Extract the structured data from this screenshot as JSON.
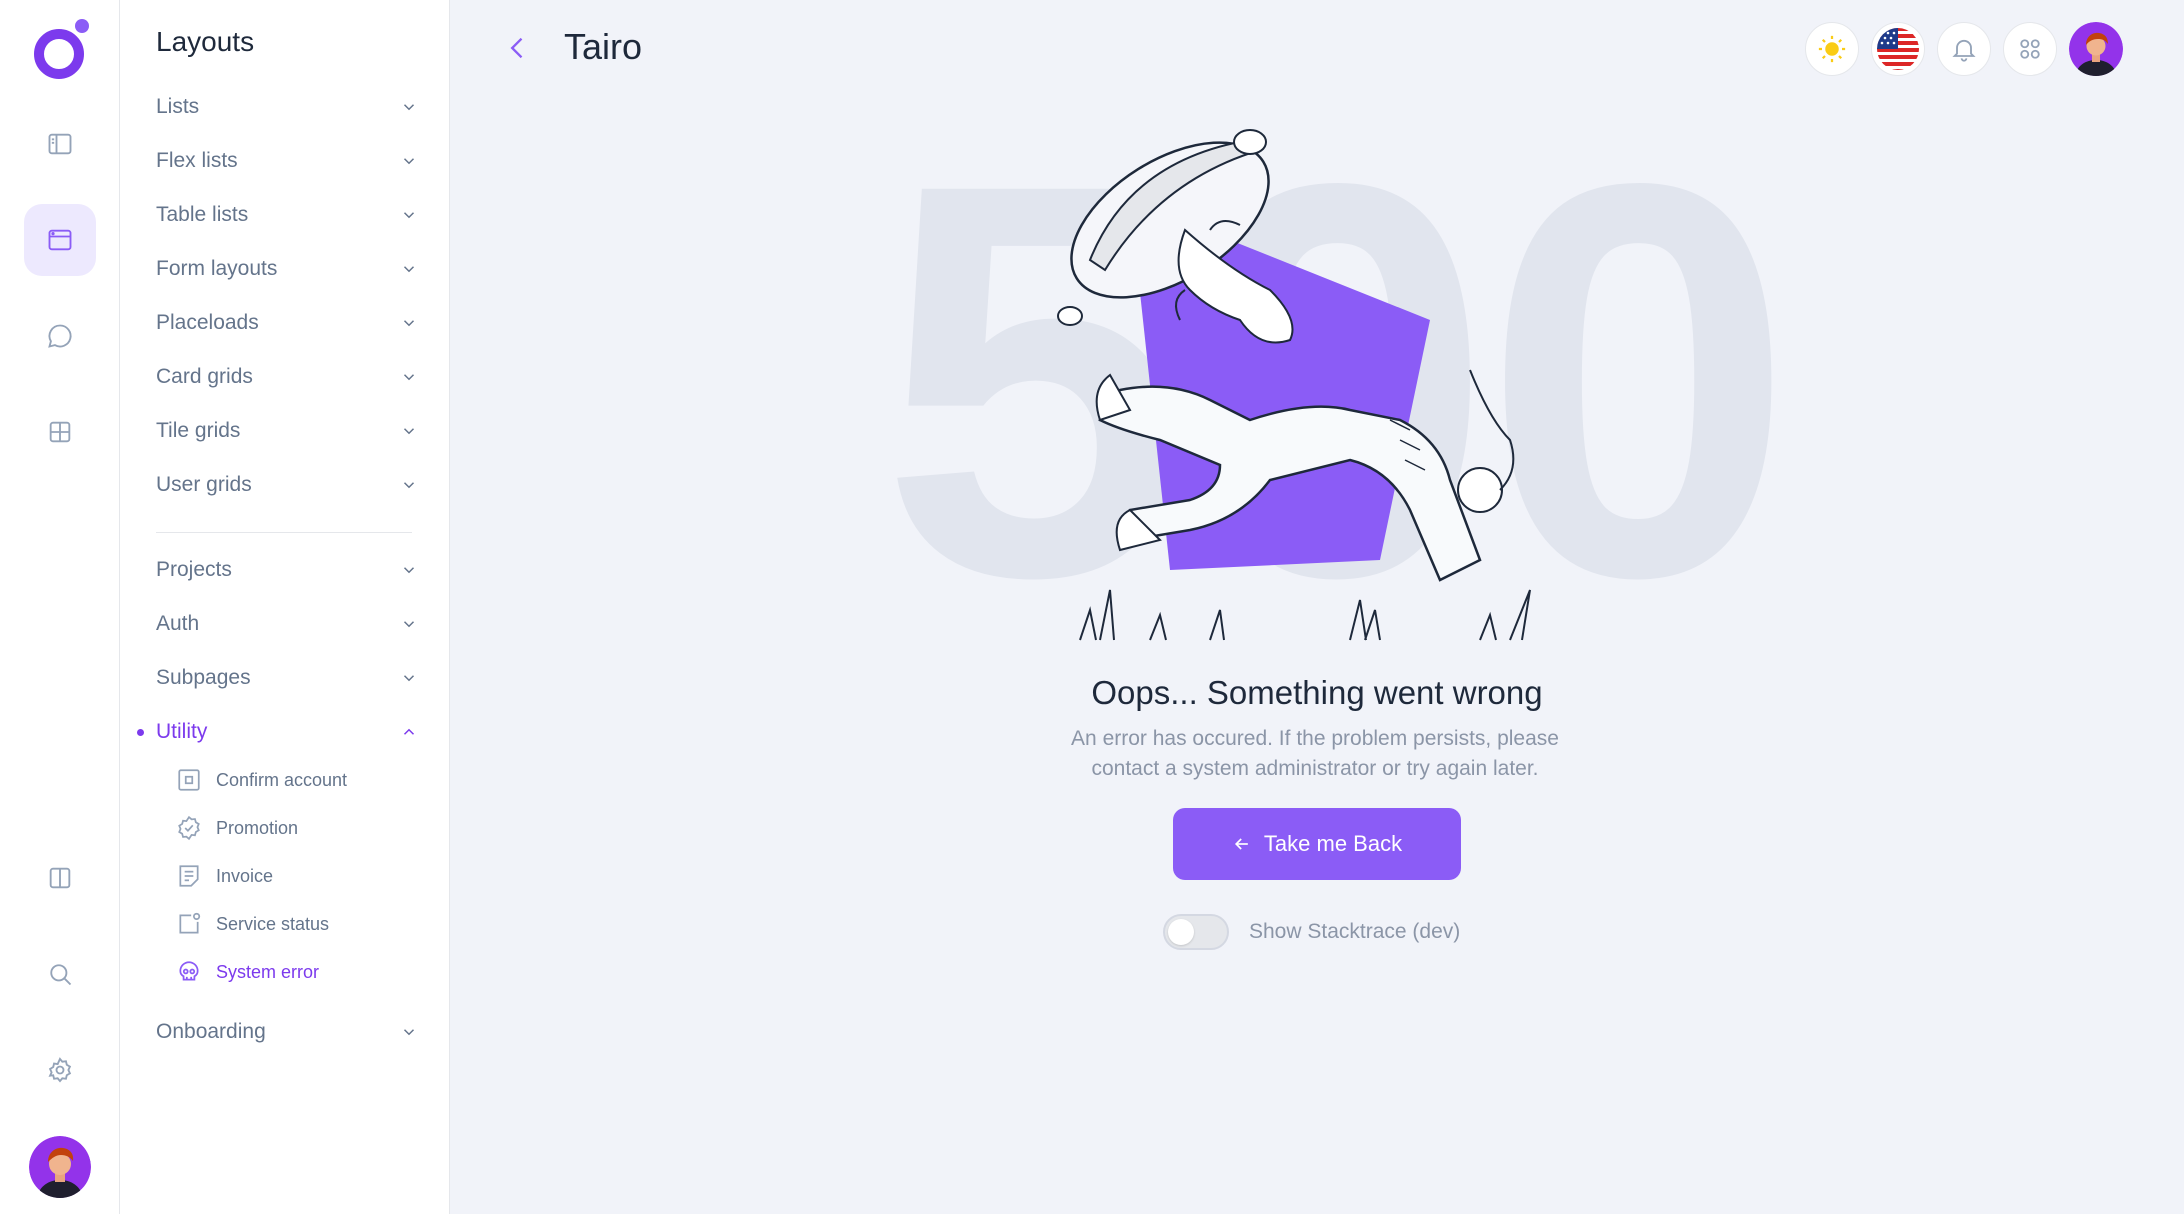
{
  "header": {
    "title": "Tairo"
  },
  "menu": {
    "title": "Layouts",
    "groups_top": [
      {
        "label": "Lists"
      },
      {
        "label": "Flex lists"
      },
      {
        "label": "Table lists"
      },
      {
        "label": "Form layouts"
      },
      {
        "label": "Placeloads"
      },
      {
        "label": "Card grids"
      },
      {
        "label": "Tile grids"
      },
      {
        "label": "User grids"
      }
    ],
    "groups_bottom": [
      {
        "label": "Projects"
      },
      {
        "label": "Auth"
      },
      {
        "label": "Subpages"
      },
      {
        "label": "Utility"
      }
    ],
    "utility_items": [
      {
        "label": "Confirm account",
        "icon": "confirm-account-icon"
      },
      {
        "label": "Promotion",
        "icon": "promotion-badge-icon"
      },
      {
        "label": "Invoice",
        "icon": "invoice-icon"
      },
      {
        "label": "Service status",
        "icon": "service-status-icon"
      },
      {
        "label": "System error",
        "icon": "skull-icon"
      }
    ],
    "last_group": {
      "label": "Onboarding"
    }
  },
  "error": {
    "code": "500",
    "title": "Oops... Something went wrong",
    "description_line1": "An error has occured. If the problem persists, please",
    "description_line2": "contact a system administrator or try again later.",
    "button_label": "Take me Back",
    "toggle_label": "Show Stacktrace (dev)",
    "toggle_on": false
  },
  "colors": {
    "accent": "#8b5cf6",
    "accent_dark": "#7c3aed",
    "background": "#f1f3f9",
    "muted_text": "#64748b"
  }
}
